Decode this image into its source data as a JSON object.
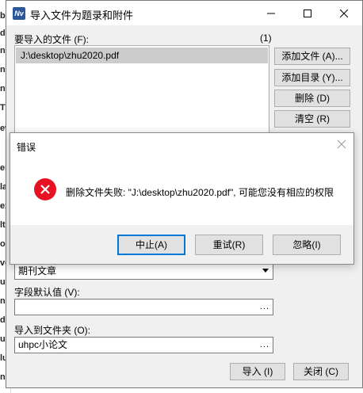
{
  "background_fragments": [
    "bl",
    "dl",
    "nsr",
    "nd",
    "ntr",
    "Th",
    "ew",
    "el",
    "lat",
    "ex",
    "lt",
    "o",
    "ver",
    "ut",
    "nd",
    "dy",
    "ut",
    "lu",
    "nd",
    "or",
    "w",
    "ne",
    "or"
  ],
  "window": {
    "title": "导入文件为题录和附件",
    "app_icon": "Nv"
  },
  "files_section": {
    "label": "要导入的文件 (F):",
    "count": "(1)",
    "items": [
      "J:\\desktop\\zhu2020.pdf"
    ]
  },
  "side_buttons": {
    "add_file": "添加文件 (A)...",
    "add_folder": "添加目录 (Y)...",
    "delete": "删除 (D)",
    "clear": "清空 (R)"
  },
  "reference_type": {
    "value": "期刊文章"
  },
  "default_value": {
    "label": "字段默认值 (V):",
    "value": "",
    "dots": "..."
  },
  "import_folder": {
    "label": "导入到文件夹 (O):",
    "value": "uhpc小论文",
    "dots": "..."
  },
  "footer": {
    "import": "导入 (I)",
    "close": "关闭 (C)"
  },
  "error_dialog": {
    "title": "错误",
    "message": "删除文件失败: \"J:\\desktop\\zhu2020.pdf\", 可能您没有相应的权限",
    "buttons": {
      "abort": "中止(A)",
      "retry": "重试(R)",
      "ignore": "忽略(I)"
    }
  },
  "colors": {
    "accent": "#0078d7",
    "error": "#e81123",
    "window_bg": "#f0f0f0",
    "selection": "#cccccc"
  }
}
